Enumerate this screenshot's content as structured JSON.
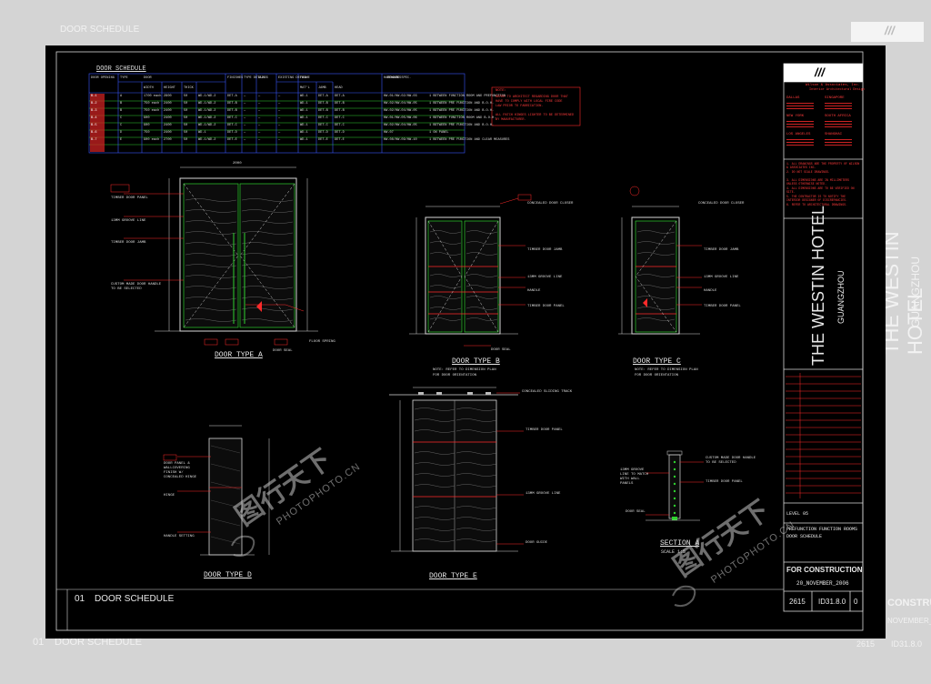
{
  "background_ghost": {
    "top_left": "DOOR SCHEDULE",
    "top_right_logo": "///",
    "right_hotel": "THE WESTIN HOTEL",
    "right_city": "GUANGZHOU",
    "right_construction": "CONSTRUCTION",
    "right_date": "NOVEMBER_2006",
    "bottom_left": "DOOR SCHEDULE",
    "bottom_number": "01",
    "bottom_right_code": "ID31.8.0",
    "bottom_right_num": "2615"
  },
  "schedule": {
    "title": "DOOR SCHEDULE",
    "headers": [
      "DOOR OPENING",
      "TYPE",
      "DOOR",
      "",
      "",
      "",
      "FINISHES",
      "TYPE DETAIL",
      "GLASS",
      "EXISTING DETAIL",
      "FRAME",
      "",
      "",
      "HARDWARE SPEC.",
      "REMARKS"
    ],
    "subheaders": [
      "",
      "",
      "WIDTH",
      "HEIGHT",
      "THICK",
      "",
      "",
      "",
      "",
      "",
      "MAT'L",
      "JAMB",
      "HEAD",
      "",
      ""
    ],
    "rows": [
      [
        "B-1",
        "A",
        "1700 each",
        "2800",
        "50",
        "WD-1/WD-2",
        "DET-A",
        "—",
        "—",
        "—",
        "WD-1",
        "DET-A",
        "DET-A",
        "HW-01/HW-02/HW-03",
        "1 BETWEEN FUNCTION ROOM AND PREFUNCTION"
      ],
      [
        "B-2",
        "B",
        "750 each",
        "2400",
        "50",
        "WD-1/WD-2",
        "DET-B",
        "—",
        "—",
        "—",
        "WD-1",
        "DET-B",
        "DET-B",
        "HW-02/HW-04/HW-05",
        "1 BETWEEN PRE FUNCTION AND B.O.H."
      ],
      [
        "B-3",
        "B",
        "750 each",
        "2400",
        "50",
        "WD-1/WD-2",
        "DET-B",
        "—",
        "—",
        "—",
        "WD-1",
        "DET-B",
        "DET-B",
        "HW-02/HW-04/HW-05",
        "1 BETWEEN PRE FUNCTION AND B.O.H."
      ],
      [
        "B-4",
        "C",
        "900",
        "2400",
        "50",
        "WD-1/WD-2",
        "DET-C",
        "—",
        "—",
        "—",
        "WD-1",
        "DET-C",
        "DET-C",
        "HW-01/HW-05/HW-06",
        "1 BETWEEN FUNCTION ROOM AND B.O.H."
      ],
      [
        "B-5",
        "C",
        "900",
        "2400",
        "50",
        "WD-1/WD-2",
        "DET-C",
        "—",
        "—",
        "—",
        "WD-1",
        "DET-C",
        "DET-C",
        "HW-02/HW-04/HW-05",
        "1 BETWEEN PRE FUNCTION AND B.O.H."
      ],
      [
        "B-6",
        "D",
        "750",
        "2400",
        "50",
        "WD-1",
        "DET-D",
        "—",
        "—",
        "—",
        "WD-1",
        "DET-D",
        "DET-D",
        "HW-07",
        "1 ON PANEL"
      ],
      [
        "B-7",
        "E",
        "900 each",
        "2700",
        "50",
        "WD-1/WD-2",
        "DET-E",
        "—",
        "—",
        "—",
        "WD-1",
        "DET-E",
        "DET-E",
        "HW-08/HW-09/HW-10",
        "1 BETWEEN PRE FUNCTION AND CLEAR MEASURES"
      ]
    ]
  },
  "note": {
    "title": "NOTE:",
    "lines": [
      "REFER TO ARCHITECT REGARDING DOOR THAT",
      "HAVE TO COMPLY WITH LOCAL FIRE CODE",
      "LAW PRIOR TO FABRICATION.",
      "",
      "ALL PATCH HINGES LIGHTER TO BE DETERMINED",
      "BY MANUFACTURER."
    ]
  },
  "drawings": {
    "type_a": "DOOR TYPE A",
    "type_b": "DOOR TYPE B",
    "type_c": "DOOR TYPE C",
    "type_d": "DOOR TYPE D",
    "type_e": "DOOR TYPE E",
    "section": "SECTION A",
    "scale": "SCALE 1:5",
    "note_b": [
      "NOTE: REFER TO DIMENSION PLAN",
      "FOR DOOR ORIENTATION"
    ],
    "note_c": [
      "NOTE: REFER TO DIMENSION PLAN",
      "FOR DOOR ORIENTATION"
    ],
    "dim_a": "2000",
    "callouts_a": [
      "TIMBER DOOR PANEL",
      "13MM GROOVE LINE",
      "TIMBER DOOR JAMB",
      "CUSTOM MADE DOOR HANDLE TO BE SELECTED",
      "FLOOR SPRING",
      "DOOR SEAL"
    ],
    "callouts_b": [
      "CONCEALED DOOR CLOSER",
      "TIMBER DOOR JAMB",
      "13MM GROOVE LINE",
      "HANDLE",
      "TIMBER DOOR PANEL",
      "DOOR SEAL"
    ],
    "callouts_c": [
      "CONCEALED DOOR CLOSER",
      "TIMBER DOOR JAMB",
      "13MM GROOVE LINE",
      "HANDLE",
      "TIMBER DOOR PANEL"
    ],
    "callouts_d": [
      "DOOR PANEL & WALLCOVERING FINISH W/ CONCEALED HINGE",
      "HINGE",
      "HANDLE SETTING"
    ],
    "callouts_e": [
      "CONCEALED SLIDING TRACK",
      "TIMBER DOOR PANEL",
      "13MM GROOVE LINE",
      "DOOR GUIDE"
    ],
    "callouts_sec": [
      "CUSTOM MADE DOOR HANDLE TO BE SELECTED",
      "TIMBER DOOR PANEL",
      "13MM GROOVE LINE TO MATCH WITH WALL PANELS",
      "DOOR SEAL"
    ]
  },
  "footer": {
    "number": "01",
    "title": "DOOR SCHEDULE"
  },
  "titleblock": {
    "logo": "///",
    "firm": "Wilson & Associates, Inc.",
    "firm_sub": "Interior Architectural Design",
    "offices": [
      "DALLAS",
      "SINGAPORE",
      "NEW YORK",
      "SOUTH AFRICA",
      "LOS ANGELES",
      "SHANGHAI"
    ],
    "general_notes": [
      "1. ALL DRAWINGS ARE THE PROPERTY OF WILSON & ASSOCIATES INC.",
      "2. DO NOT SCALE DRAWINGS.",
      "3. ALL DIMENSIONS ARE IN MILLIMETERS UNLESS OTHERWISE NOTED.",
      "4. ALL DIMENSIONS ARE TO BE VERIFIED ON SITE.",
      "5. THE CONTRACTOR IS TO NOTIFY THE INTERIOR DESIGNER OF DISCREPANCIES.",
      "6. REFER TO ARCHITECTURAL DRAWINGS."
    ],
    "hotel": "THE WESTIN HOTEL",
    "city": "GUANGZHOU",
    "level": "LEVEL 05",
    "drawing_title_1": "PREFUNCTION FUNCTION ROOMS",
    "drawing_title_2": "DOOR SCHEDULE",
    "status": "FOR CONSTRUCTION",
    "date": "20_NOVEMBER_2006",
    "project_no": "2615",
    "drawing_no": "ID31.8.0",
    "revision": "0"
  },
  "watermark": {
    "brand": "图行天下",
    "url": "PHOTOPHOTO.CN"
  },
  "colors": {
    "sheet": "#000000",
    "line": "#d8d8d8",
    "red": "#ff2a2a",
    "green": "#2fd02f",
    "blue": "#3a57ff",
    "yellow": "#e8d040"
  }
}
